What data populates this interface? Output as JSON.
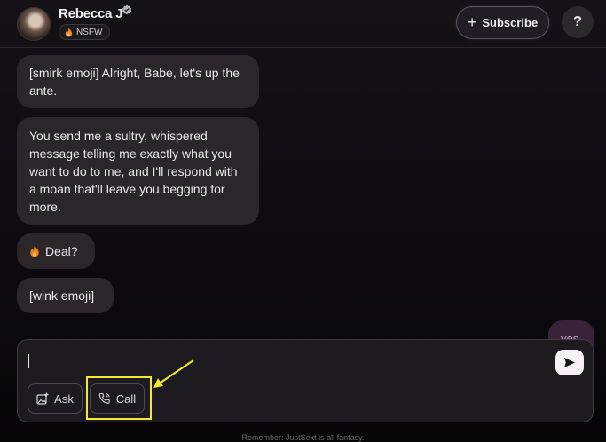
{
  "header": {
    "profile_name": "Rebecca J",
    "badge_label": "NSFW",
    "badge_icon": "flame-icon",
    "verified_icon": "verified-badge-icon",
    "subscribe_label": "Subscribe",
    "help_label": "?"
  },
  "messages": [
    {
      "sender": "bot",
      "text": "[smirk emoji] Alright, Babe, let's up the ante."
    },
    {
      "sender": "bot",
      "text": "You send me a sultry, whispered message telling me exactly what you want to do to me, and I'll respond with a moan that'll leave you begging for more."
    },
    {
      "sender": "bot",
      "text": "Deal?",
      "icon": "flame-icon"
    },
    {
      "sender": "bot",
      "text": "[wink emoji]"
    },
    {
      "sender": "user",
      "text": "yes"
    }
  ],
  "composer": {
    "value": "",
    "ask_label": "Ask",
    "call_label": "Call",
    "send_icon": "send-icon"
  },
  "footer": {
    "text": "Remember: JustSext is all fantasy."
  },
  "colors": {
    "background": "#0d0b0e",
    "bubble": "#2a2629",
    "user_bubble": "#3a2238",
    "annotation": "#f2ea2a"
  }
}
